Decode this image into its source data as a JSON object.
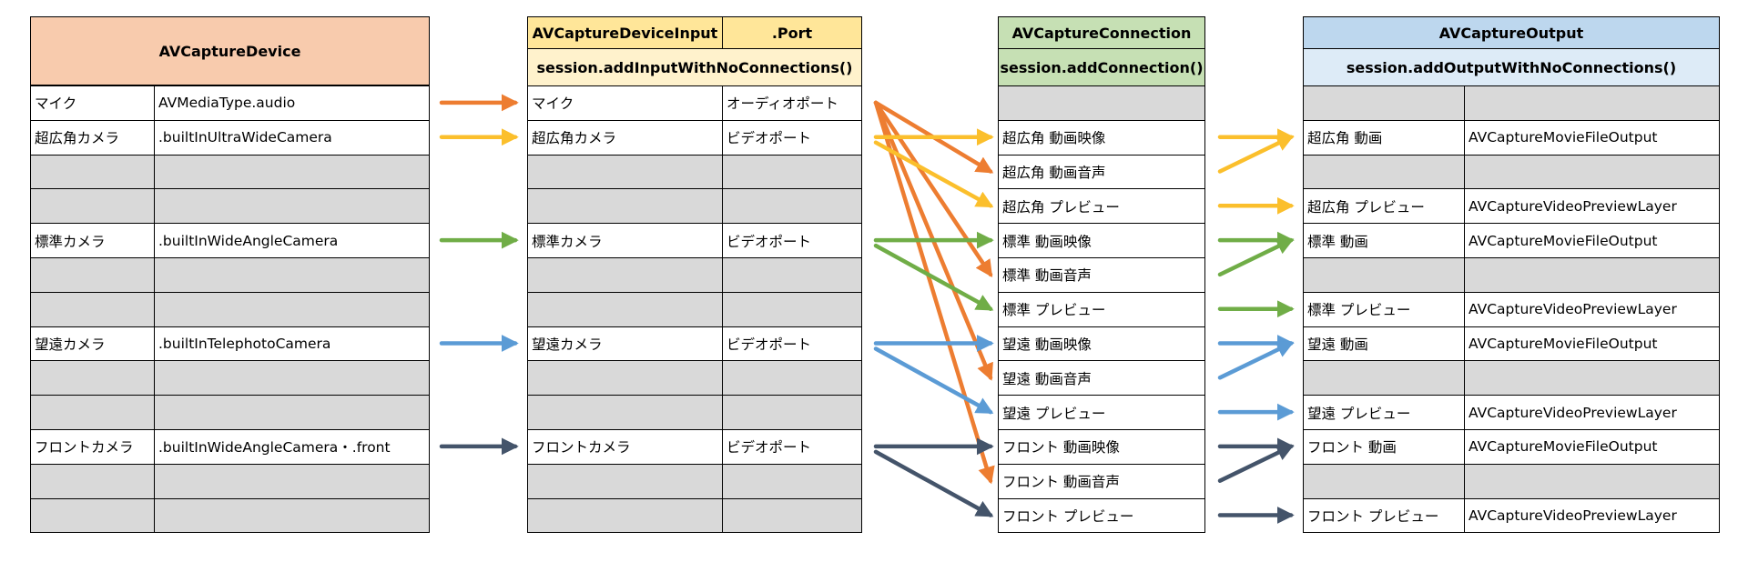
{
  "colors": {
    "orange": "#ed7d31",
    "yellow": "#fbbf2c",
    "green": "#70ad47",
    "blue": "#5b9bd5",
    "navy": "#44546a",
    "device_header": "#f8cbad",
    "input_header": "#ffe699",
    "input_subheader": "#fff2cc",
    "connection_header": "#c6e0b4",
    "output_header": "#bdd7ee",
    "output_subheader": "#ddebf7",
    "empty_cell": "#d9d9d9"
  },
  "device": {
    "title": "AVCaptureDevice",
    "rows": [
      {
        "name": "マイク",
        "type": "AVMediaType.audio"
      },
      {
        "name": "超広角カメラ",
        "type": ".builtInUltraWideCamera"
      },
      {
        "name": "",
        "type": ""
      },
      {
        "name": "",
        "type": ""
      },
      {
        "name": "標準カメラ",
        "type": ".builtInWideAngleCamera"
      },
      {
        "name": "",
        "type": ""
      },
      {
        "name": "",
        "type": ""
      },
      {
        "name": "望遠カメラ",
        "type": ".builtInTelephotoCamera"
      },
      {
        "name": "",
        "type": ""
      },
      {
        "name": "",
        "type": ""
      },
      {
        "name": "フロントカメラ",
        "type": ".builtInWideAngleCamera・.front"
      },
      {
        "name": "",
        "type": ""
      },
      {
        "name": "",
        "type": ""
      }
    ]
  },
  "input": {
    "title": "AVCaptureDeviceInput",
    "port_title": ".Port",
    "subtitle": "session.addInputWithNoConnections()",
    "rows": [
      {
        "name": "マイク",
        "port": "オーディオポート"
      },
      {
        "name": "超広角カメラ",
        "port": "ビデオポート"
      },
      {
        "name": "",
        "port": ""
      },
      {
        "name": "",
        "port": ""
      },
      {
        "name": "標準カメラ",
        "port": "ビデオポート"
      },
      {
        "name": "",
        "port": ""
      },
      {
        "name": "",
        "port": ""
      },
      {
        "name": "望遠カメラ",
        "port": "ビデオポート"
      },
      {
        "name": "",
        "port": ""
      },
      {
        "name": "",
        "port": ""
      },
      {
        "name": "フロントカメラ",
        "port": "ビデオポート"
      },
      {
        "name": "",
        "port": ""
      },
      {
        "name": "",
        "port": ""
      }
    ]
  },
  "connection": {
    "title": "AVCaptureConnection",
    "subtitle": "session.addConnection()",
    "rows": [
      "",
      "超広角 動画映像",
      "超広角 動画音声",
      "超広角 プレビュー",
      "標準 動画映像",
      "標準 動画音声",
      "標準 プレビュー",
      "望遠 動画映像",
      "望遠 動画音声",
      "望遠 プレビュー",
      "フロント 動画映像",
      "フロント 動画音声",
      "フロント プレビュー"
    ]
  },
  "output": {
    "title": "AVCaptureOutput",
    "subtitle": "session.addOutputWithNoConnections()",
    "rows": [
      {
        "name": "",
        "type": ""
      },
      {
        "name": "超広角 動画",
        "type": "AVCaptureMovieFileOutput"
      },
      {
        "name": "",
        "type": ""
      },
      {
        "name": "超広角 プレビュー",
        "type": "AVCaptureVideoPreviewLayer"
      },
      {
        "name": "標準 動画",
        "type": "AVCaptureMovieFileOutput"
      },
      {
        "name": "",
        "type": ""
      },
      {
        "name": "標準 プレビュー",
        "type": "AVCaptureVideoPreviewLayer"
      },
      {
        "name": "望遠 動画",
        "type": "AVCaptureMovieFileOutput"
      },
      {
        "name": "",
        "type": ""
      },
      {
        "name": "望遠 プレビュー",
        "type": "AVCaptureVideoPreviewLayer"
      },
      {
        "name": "フロント 動画",
        "type": "AVCaptureMovieFileOutput"
      },
      {
        "name": "",
        "type": ""
      },
      {
        "name": "フロント プレビュー",
        "type": "AVCaptureVideoPreviewLayer"
      }
    ]
  },
  "links": [
    {
      "stage": "device-input",
      "from": 0,
      "to": 0,
      "color": "orange"
    },
    {
      "stage": "device-input",
      "from": 1,
      "to": 1,
      "color": "yellow"
    },
    {
      "stage": "device-input",
      "from": 4,
      "to": 4,
      "color": "green"
    },
    {
      "stage": "device-input",
      "from": 7,
      "to": 7,
      "color": "blue"
    },
    {
      "stage": "device-input",
      "from": 10,
      "to": 10,
      "color": "navy"
    },
    {
      "stage": "input-connection",
      "from": 0,
      "to": 2,
      "color": "orange"
    },
    {
      "stage": "input-connection",
      "from": 0,
      "to": 5,
      "color": "orange"
    },
    {
      "stage": "input-connection",
      "from": 0,
      "to": 8,
      "color": "orange"
    },
    {
      "stage": "input-connection",
      "from": 0,
      "to": 11,
      "color": "orange"
    },
    {
      "stage": "input-connection",
      "from": 1,
      "to": 1,
      "color": "yellow"
    },
    {
      "stage": "input-connection",
      "from": 1,
      "to": 3,
      "color": "yellow"
    },
    {
      "stage": "input-connection",
      "from": 4,
      "to": 4,
      "color": "green"
    },
    {
      "stage": "input-connection",
      "from": 4,
      "to": 6,
      "color": "green"
    },
    {
      "stage": "input-connection",
      "from": 7,
      "to": 7,
      "color": "blue"
    },
    {
      "stage": "input-connection",
      "from": 7,
      "to": 9,
      "color": "blue"
    },
    {
      "stage": "input-connection",
      "from": 10,
      "to": 10,
      "color": "navy"
    },
    {
      "stage": "input-connection",
      "from": 10,
      "to": 12,
      "color": "navy"
    },
    {
      "stage": "connection-output",
      "from": 1,
      "to": 1,
      "color": "yellow"
    },
    {
      "stage": "connection-output",
      "from": 2,
      "to": 1,
      "color": "yellow"
    },
    {
      "stage": "connection-output",
      "from": 3,
      "to": 3,
      "color": "yellow"
    },
    {
      "stage": "connection-output",
      "from": 4,
      "to": 4,
      "color": "green"
    },
    {
      "stage": "connection-output",
      "from": 5,
      "to": 4,
      "color": "green"
    },
    {
      "stage": "connection-output",
      "from": 6,
      "to": 6,
      "color": "green"
    },
    {
      "stage": "connection-output",
      "from": 7,
      "to": 7,
      "color": "blue"
    },
    {
      "stage": "connection-output",
      "from": 8,
      "to": 7,
      "color": "blue"
    },
    {
      "stage": "connection-output",
      "from": 9,
      "to": 9,
      "color": "blue"
    },
    {
      "stage": "connection-output",
      "from": 10,
      "to": 10,
      "color": "navy"
    },
    {
      "stage": "connection-output",
      "from": 11,
      "to": 10,
      "color": "navy"
    },
    {
      "stage": "connection-output",
      "from": 12,
      "to": 12,
      "color": "navy"
    }
  ]
}
